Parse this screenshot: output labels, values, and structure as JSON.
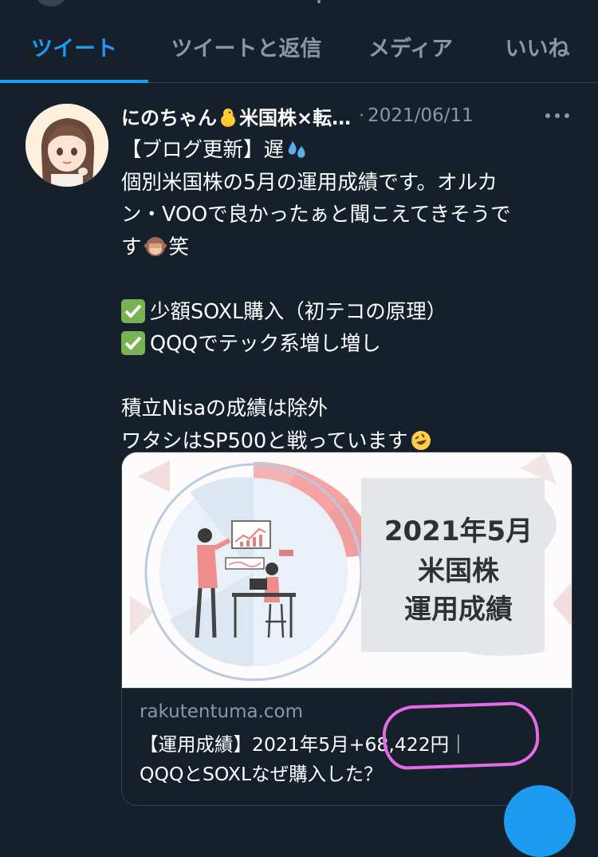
{
  "tabs": [
    {
      "label": "ツイート",
      "active": true
    },
    {
      "label": "ツイートと返信",
      "active": false
    },
    {
      "label": "メディア",
      "active": false
    },
    {
      "label": "いいね",
      "active": false
    }
  ],
  "tweet": {
    "name_part1": "にのちゃん",
    "name_part2": "米国株×転…",
    "separator": "·",
    "date": "2021/06/11",
    "lines": {
      "l1": "【ブログ更新】遅",
      "l2": "個別米国株の5月の運用成績です。オルカ",
      "l3": "ン・VOOで良かったぁと聞こえてきそうで",
      "l4a": "す",
      "l4b": "笑",
      "l5": "少額SOXL購入（初テコの原理）",
      "l6": "QQQでテック系増し増し",
      "l7": "積立Nisaの成績は除外",
      "l8": "ワタシはSP500と戦っています"
    },
    "emoji_icons": [
      "baby-chick-icon",
      "sweat-droplets-icon",
      "see-no-evil-monkey-icon",
      "check-mark-button-icon",
      "rolling-on-floor-laughing-icon"
    ]
  },
  "card": {
    "image_title_line1": "2021年5月",
    "image_title_line2": "米国株",
    "image_title_line3": "運用成績",
    "domain": "rakutentuma.com",
    "title_line1": "【運用成績】2021年5月+68,422円｜",
    "title_line2": "QQQとSOXLなぜ購入した？"
  },
  "colors": {
    "background": "#15202b",
    "accent": "#1d9bf0",
    "secondary_text": "#8899a6",
    "highlight_circle": "#e46ae8"
  }
}
